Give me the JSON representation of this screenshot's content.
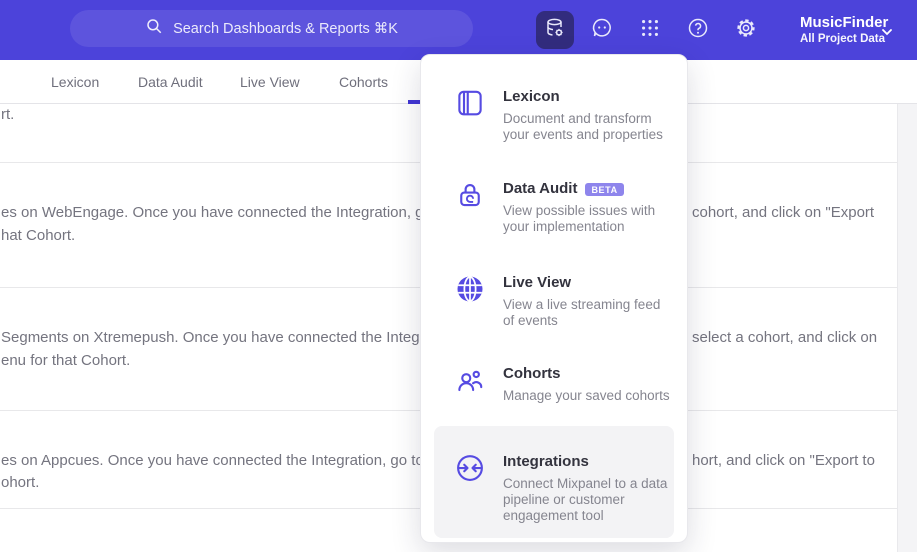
{
  "colors": {
    "header": "#4c43da",
    "accent": "#4135d4",
    "icon_purple": "#564be2",
    "tile": "#322c7e",
    "badge": "#8e85ec",
    "highlight_row": "#f3f3f5"
  },
  "header": {
    "search": {
      "placeholder": "Search Dashboards & Reports ⌘K"
    },
    "icons": [
      "data-management-icon",
      "feedback-icon",
      "apps-grid-icon",
      "help-icon",
      "settings-icon"
    ],
    "project": {
      "name": "MusicFinder",
      "scope": "All Project Data"
    }
  },
  "tabs": [
    {
      "label": "Lexicon"
    },
    {
      "label": "Data Audit"
    },
    {
      "label": "Live View"
    },
    {
      "label": "Cohorts"
    }
  ],
  "menu": {
    "items": [
      {
        "title": "Lexicon",
        "desc": "Document and transform your events and properties"
      },
      {
        "title": "Data Audit",
        "badge": "BETA",
        "desc": "View possible issues with your implementation"
      },
      {
        "title": "Live View",
        "desc": "View a live streaming feed of events"
      },
      {
        "title": "Cohorts",
        "desc": "Manage your saved cohorts"
      },
      {
        "title": "Integrations",
        "desc": "Connect Mixpanel to a data pipeline or customer engagement tool"
      }
    ]
  },
  "content": {
    "rows": [
      {
        "left1": "rt.",
        "right1": "",
        "left2": ""
      },
      {
        "left1": "es on WebEngage. Once you have connected the Integration, go to the",
        "right1": "cohort, and click on \"Export",
        "left2": "hat Cohort."
      },
      {
        "left1": "Segments on Xtremepush. Once you have connected the Integration,",
        "right1": "select a cohort, and click on",
        "left2": "enu for that Cohort."
      },
      {
        "left1": "es on Appcues. Once you have connected the Integration, go to the M",
        "right1": "hort, and click on \"Export to",
        "left2": "ohort."
      }
    ]
  }
}
